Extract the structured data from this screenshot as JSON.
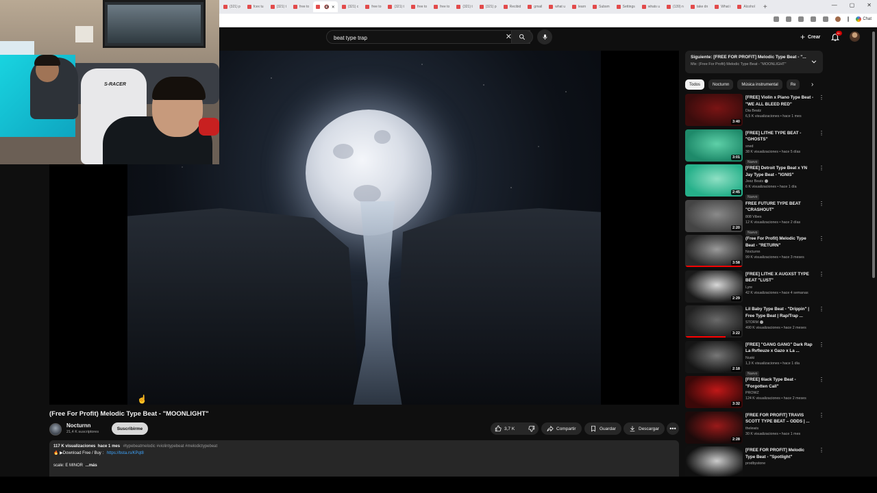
{
  "browser": {
    "tabs": [
      {
        "label": "(321) p",
        "active": false
      },
      {
        "label": "fcex tu",
        "active": false
      },
      {
        "label": "(321) t",
        "active": false
      },
      {
        "label": "free to",
        "active": false
      },
      {
        "label": "",
        "active": true
      },
      {
        "label": "(321) c",
        "active": false
      },
      {
        "label": "free to",
        "active": false
      },
      {
        "label": "(321) t",
        "active": false
      },
      {
        "label": "free to",
        "active": false
      },
      {
        "label": "free to",
        "active": false
      },
      {
        "label": "(321) t",
        "active": false
      },
      {
        "label": "(321) p",
        "active": false
      },
      {
        "label": "Recibid",
        "active": false
      },
      {
        "label": "gmail",
        "active": false
      },
      {
        "label": "what u",
        "active": false
      },
      {
        "label": "learn",
        "active": false
      },
      {
        "label": "Subsm",
        "active": false
      },
      {
        "label": "Settings",
        "active": false
      },
      {
        "label": "whats u",
        "active": false
      },
      {
        "label": "(139) n",
        "active": false
      },
      {
        "label": "take dn",
        "active": false
      },
      {
        "label": "What i",
        "active": false
      },
      {
        "label": "Alcohol",
        "active": false
      }
    ],
    "new_tab": "+",
    "chat_label": "Chat"
  },
  "header": {
    "search_value": "beat type trap",
    "create_label": "Crear",
    "notifications_badge": "9+"
  },
  "video": {
    "title": "(Free For Profit) Melodic Type Beat - \"MOONLIGHT\"",
    "channel": "Nocturnn",
    "subscribers": "21,4 K suscriptores",
    "subscribe_label": "Suscribirme",
    "likes": "3,7 K",
    "share_label": "Compartir",
    "save_label": "Guardar",
    "download_label": "Descargar",
    "webcam_chair_label": "S-RACER"
  },
  "description": {
    "views": "117 K visualizaciones",
    "age": "hace 1 mes",
    "tags": "#typebeatmelodic #violintypebeat #melodictypebeat",
    "line2_prefix": "▶Download Free / Buy :",
    "link": "https://bsta.rs/KPqt8",
    "line3": "scale: E MINOR",
    "more": "...más"
  },
  "playlist": {
    "title": "Siguiente: [FREE FOR PROFIT] Melodic Type Beat - \"...",
    "subtitle": "Mix: (Free For Profit) Melodic Type Beat - \"MOONLIGHT\""
  },
  "chips": [
    {
      "label": "Todos",
      "active": true
    },
    {
      "label": "Nocturnn",
      "active": false
    },
    {
      "label": "Música instrumental",
      "active": false
    },
    {
      "label": "Re",
      "active": false
    }
  ],
  "recommendations": [
    {
      "title": "[FREE] Violin x Piano Type Beat - \"WE ALL BLEED RED\"",
      "channel": "Dia Beatz",
      "stats": "6,5 K visualizaciones • hace 1 mes",
      "duration": "3:40",
      "badge": "",
      "verified": false,
      "thumb": "#3a0c0c",
      "thumb2": "#7a1414"
    },
    {
      "title": "[FREE] LITHE TYPE BEAT - \"GHOSTS\"",
      "channel": "sned",
      "stats": "38 K visualizaciones • hace 5 días",
      "duration": "3:01",
      "badge": "Nuevo",
      "verified": false,
      "thumb": "#1e8a6a",
      "thumb2": "#5ed0a8"
    },
    {
      "title": "[FREE] Detroit Type Beat x YN Jay Type Beat - \"IGNIS\"",
      "channel": "Jeez Beats",
      "stats": "6 K visualizaciones • hace 1 día",
      "duration": "2:45",
      "badge": "Nuevo",
      "verified": true,
      "thumb": "#26b08a",
      "thumb2": "#8fe0c4"
    },
    {
      "title": "FREE FUTURE TYPE BEAT \"CRASHOUT\"",
      "channel": "808 Vibes",
      "stats": "12 K visualizaciones • hace 2 días",
      "duration": "2:20",
      "badge": "Nuevo",
      "verified": false,
      "thumb": "#444444",
      "thumb2": "#8a8a8a"
    },
    {
      "title": "(Free For Profit) Melodic Type Beat - \"RETURN\"",
      "channel": "Nocturnn",
      "stats": "99 K visualizaciones • hace 3 meses",
      "duration": "3:58",
      "badge": "",
      "verified": false,
      "thumb": "#2a2a2a",
      "thumb2": "#9a9a9a",
      "progress": 1.0
    },
    {
      "title": "[FREE] LITHE X AUGXST TYPE BEAT \"LUST\"",
      "channel": "Lyre",
      "stats": "42 K visualizaciones • hace 4 semanas",
      "duration": "2:29",
      "badge": "",
      "verified": false,
      "thumb": "#1a1a1a",
      "thumb2": "#d8d8d8"
    },
    {
      "title": "Lil Baby Type Beat - \"Drippin\" | Free Type Beat | Rap/Trap ...",
      "channel": "STORM",
      "stats": "490 K visualizaciones • hace 2 meses",
      "duration": "3:22",
      "badge": "",
      "verified": true,
      "thumb": "#202020",
      "thumb2": "#6a6a6a",
      "progress": 0.7
    },
    {
      "title": "[FREE] \"GANG GANG\" Dark Rap La Rvfleuze x Gazo x La ...",
      "channel": "Nuski",
      "stats": "1,3 K visualizaciones • hace 1 día",
      "duration": "2:18",
      "badge": "Nuevo",
      "verified": false,
      "thumb": "#151515",
      "thumb2": "#777777"
    },
    {
      "title": "[FREE] 6lack Type Beat - \"Forgotten Call\"",
      "channel": "PROWZ",
      "stats": "124 K visualizaciones • hace 2 meses",
      "duration": "3:32",
      "badge": "",
      "verified": false,
      "thumb": "#3a0808",
      "thumb2": "#c01818"
    },
    {
      "title": "[FREE FOR PROFIT] TRAVIS SCOTT TYPE BEAT – ODDS | ...",
      "channel": "thelewis",
      "stats": "30 K visualizaciones • hace 1 mes",
      "duration": "2:28",
      "badge": "",
      "verified": false,
      "thumb": "#1c0a0a",
      "thumb2": "#9a1a1a"
    },
    {
      "title": "[FREE FOR PROFIT] Melodic Type Beat - \"Spotlight\"",
      "channel": "prodbystone",
      "stats": "",
      "duration": "",
      "badge": "",
      "verified": false,
      "thumb": "#101010",
      "thumb2": "#cccccc"
    }
  ]
}
